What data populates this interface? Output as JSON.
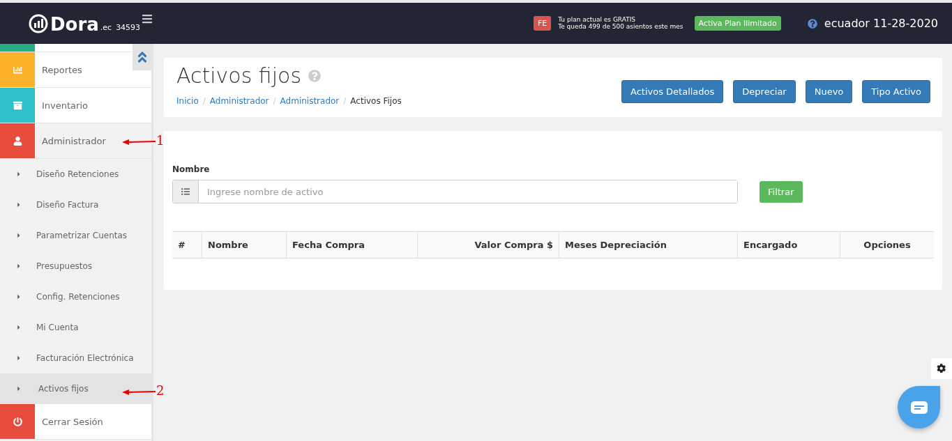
{
  "header": {
    "logo": "Dora",
    "logo_suffix": ".ec",
    "account": "34593",
    "plan_badge": "FE",
    "plan_lines": [
      "Tu plan actual es GRATIS",
      "Te queda 499 de 500 asientos este mes"
    ],
    "upgrade_button": "Activa Plan Ilimitado",
    "user": "ecuador 11-28-2020"
  },
  "sidebar": {
    "items": [
      {
        "kind": "main",
        "color": "#26ad86",
        "selected": false
      },
      {
        "kind": "main",
        "label": "Reportes",
        "color": "#fbb12a",
        "selected": false
      },
      {
        "kind": "main",
        "label": "Inventario",
        "color": "#2dc0c9",
        "selected": false
      },
      {
        "kind": "main",
        "label": "Administrador",
        "color": "#e74c3c",
        "selected": true
      },
      {
        "kind": "sub",
        "label": "Diseño Retenciones",
        "selected": false
      },
      {
        "kind": "sub",
        "label": "Diseño Factura",
        "selected": false
      },
      {
        "kind": "sub",
        "label": "Parametrizar Cuentas",
        "selected": false
      },
      {
        "kind": "sub",
        "label": "Presupuestos",
        "selected": false
      },
      {
        "kind": "sub",
        "label": "Config. Retenciones",
        "selected": false
      },
      {
        "kind": "sub",
        "label": "Mi Cuenta",
        "selected": false
      },
      {
        "kind": "sub",
        "label": "Facturación Electrónica",
        "selected": false
      },
      {
        "kind": "sub",
        "label": "Activos fijos",
        "selected": true
      },
      {
        "kind": "main",
        "label": "Cerrar Sesión",
        "color": "#e74c3c",
        "selected": false
      }
    ]
  },
  "page": {
    "title": "Activos fijos",
    "breadcrumb": [
      {
        "kind": "link",
        "label": "Inicio"
      },
      {
        "kind": "separator",
        "label": "/"
      },
      {
        "kind": "link",
        "label": "Administrador"
      },
      {
        "kind": "separator",
        "label": "/"
      },
      {
        "kind": "link",
        "label": "Administrador"
      },
      {
        "kind": "separator",
        "label": "/"
      },
      {
        "kind": "current",
        "label": "Activos Fijos"
      }
    ],
    "buttons": [
      "Activos Detallados",
      "Depreciar",
      "Nuevo",
      "Tipo Activo"
    ]
  },
  "filter": {
    "label": "Nombre",
    "placeholder": "Ingrese nombre de activo",
    "button": "Filtrar"
  },
  "table": {
    "columns": [
      "#",
      "Nombre",
      "Fecha Compra",
      "Valor Compra $",
      "Meses Depreciación",
      "Encargado",
      "Opciones"
    ]
  },
  "annotations": [
    "1",
    "2"
  ]
}
